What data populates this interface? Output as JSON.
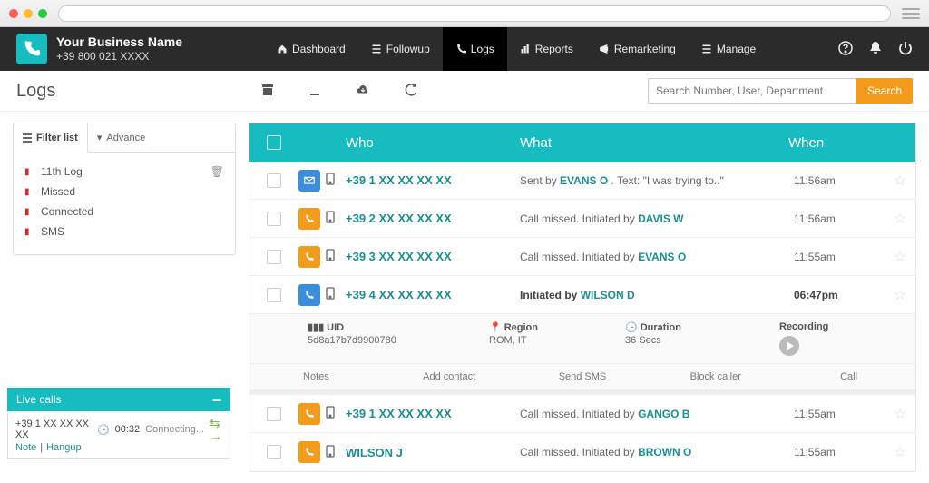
{
  "colors": {
    "accent": "#17bcc0",
    "orange": "#f39c1c",
    "blue": "#3b8ede"
  },
  "business": {
    "name": "Your Business Name",
    "phone": "+39 800 021 XXXX"
  },
  "nav": {
    "dashboard": "Dashboard",
    "followup": "Followup",
    "logs": "Logs",
    "reports": "Reports",
    "remarketing": "Remarketing",
    "manage": "Manage"
  },
  "page": {
    "title": "Logs"
  },
  "search": {
    "placeholder": "Search Number, User, Department",
    "button": "Search"
  },
  "filter": {
    "tab_list": "Filter list",
    "tab_advance": "Advance",
    "items": {
      "i0": "11th Log",
      "i1": "Missed",
      "i2": "Connected",
      "i3": "SMS"
    }
  },
  "thead": {
    "who": "Who",
    "what": "What",
    "when": "When"
  },
  "rows": {
    "r0": {
      "who": "+39 1 XX XX XX XX",
      "what_pre": "Sent by ",
      "user": "EVANS O",
      "what_post": " . Text: \"I was trying to..\"",
      "when": "11:56am"
    },
    "r1": {
      "who": "+39 2 XX XX XX XX",
      "what_pre": "Call missed. Initiated by ",
      "user": "DAVIS  W",
      "what_post": "",
      "when": "11:56am"
    },
    "r2": {
      "who": "+39 3 XX XX XX XX",
      "what_pre": "Call missed. Initiated by ",
      "user": "EVANS O",
      "what_post": "",
      "when": "11:55am"
    },
    "r3": {
      "who": "+39 4 XX XX XX XX",
      "what_pre": "Initiated by  ",
      "user": "WILSON D",
      "what_post": "",
      "when": "06:47pm"
    },
    "r4": {
      "who": "+39 1 XX XX XX XX",
      "what_pre": "Call missed. Initiated by ",
      "user": "GANGO  B",
      "what_post": "",
      "when": "11:55am"
    },
    "r5": {
      "who": "WILSON J",
      "what_pre": "Call missed. Initiated by ",
      "user": "BROWN O",
      "what_post": "",
      "when": "11:55am"
    }
  },
  "detail": {
    "uid_lbl": "UID",
    "uid_val": "5d8a17b7d9900780",
    "region_lbl": "Region",
    "region_val": "ROM, IT",
    "duration_lbl": "Duration",
    "duration_val": "36 Secs",
    "recording_lbl": "Recording",
    "actions": {
      "notes": "Notes",
      "add": "Add contact",
      "sms": "Send SMS",
      "block": "Block caller",
      "call": "Call"
    }
  },
  "live": {
    "title": "Live calls",
    "number": "+39 1 XX XX XX XX",
    "timer": "00:32",
    "status": "Connecting...",
    "note": "Note",
    "hangup": "Hangup"
  }
}
